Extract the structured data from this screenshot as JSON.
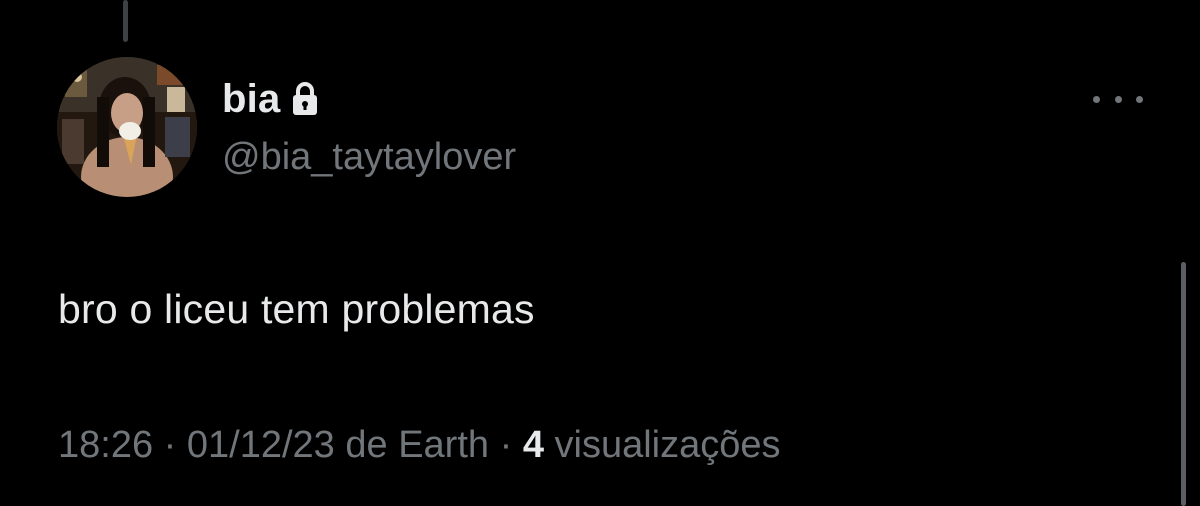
{
  "tweet": {
    "display_name": "bia",
    "handle": "@bia_taytaylover",
    "text": "bro o liceu tem problemas",
    "time": "18:26",
    "separator": "·",
    "date": "01/12/23",
    "source_prefix": "de",
    "source": "Earth",
    "views_count": "4",
    "views_label": "visualizações",
    "protected_icon": "lock-icon",
    "more_icon": "ellipsis-icon"
  },
  "colors": {
    "background": "#000000",
    "primary_text": "#e7e9ea",
    "secondary_text": "#71767b",
    "thread_line": "#3e4144"
  }
}
